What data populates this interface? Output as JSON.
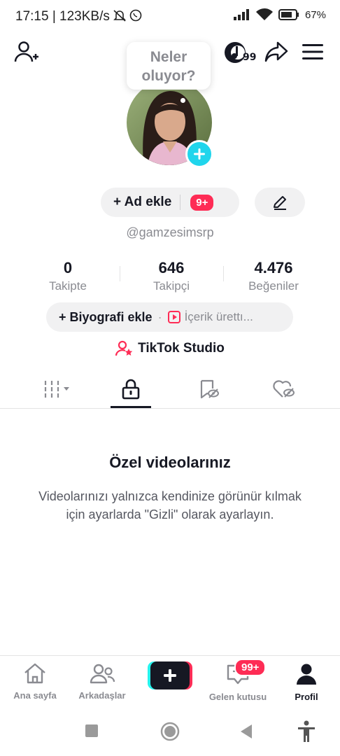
{
  "status": {
    "time": "17:15 | 123KB/s",
    "battery": "67%"
  },
  "bubble": {
    "text_line1": "Neler",
    "text_line2": "oluyor?"
  },
  "profile": {
    "add_name_label": "+ Ad ekle",
    "add_name_badge": "9+",
    "username": "@gamzesimsrp"
  },
  "stats": [
    {
      "value": "0",
      "label": "Takipte"
    },
    {
      "value": "646",
      "label": "Takipçi"
    },
    {
      "value": "4.476",
      "label": "Beğeniler"
    }
  ],
  "bio": {
    "main": "+ Biyografi ekle",
    "separator": "·",
    "secondary": "İçerik ürettı..."
  },
  "studio": {
    "label": "TikTok Studio"
  },
  "top_badge": "99",
  "empty_state": {
    "title": "Özel videolarınız",
    "description": "Videolarınızı yalnızca kendinize görünür kılmak için ayarlarda \"Gizli\" olarak ayarlayın."
  },
  "nav": {
    "home": "Ana sayfa",
    "friends": "Arkadaşlar",
    "inbox": "Gelen kutusu",
    "inbox_badge": "99+",
    "profile": "Profil"
  },
  "colors": {
    "accent_pink": "#fe2c55",
    "accent_cyan": "#20d5ec",
    "text_dark": "#161823",
    "text_gray": "#8a8b91"
  }
}
